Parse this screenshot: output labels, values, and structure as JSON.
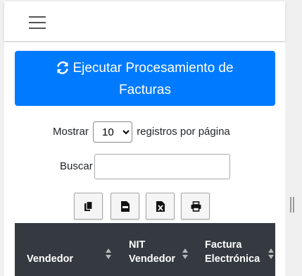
{
  "navbar": {
    "menu_icon": "hamburger-icon"
  },
  "process_button": {
    "icon": "sync-icon",
    "label_line1": "Ejecutar Procesamiento de",
    "label_line2": "Facturas"
  },
  "length_control": {
    "prefix": "Mostrar",
    "selected": "10",
    "suffix": "registros por página"
  },
  "search": {
    "label": "Buscar",
    "value": ""
  },
  "export_buttons": [
    {
      "name": "copy",
      "icon": "copy-icon"
    },
    {
      "name": "csv",
      "icon": "csv-icon"
    },
    {
      "name": "excel",
      "icon": "excel-icon"
    },
    {
      "name": "print",
      "icon": "print-icon"
    }
  ],
  "table": {
    "header_bg": "#343a40",
    "columns": [
      {
        "line1": "",
        "line2": "Vendedor"
      },
      {
        "line1": "NIT",
        "line2": "Vendedor"
      },
      {
        "line1": "Factura",
        "line2": "Electrónica"
      }
    ]
  },
  "colors": {
    "primary": "#007bff",
    "table_header": "#343a40"
  }
}
